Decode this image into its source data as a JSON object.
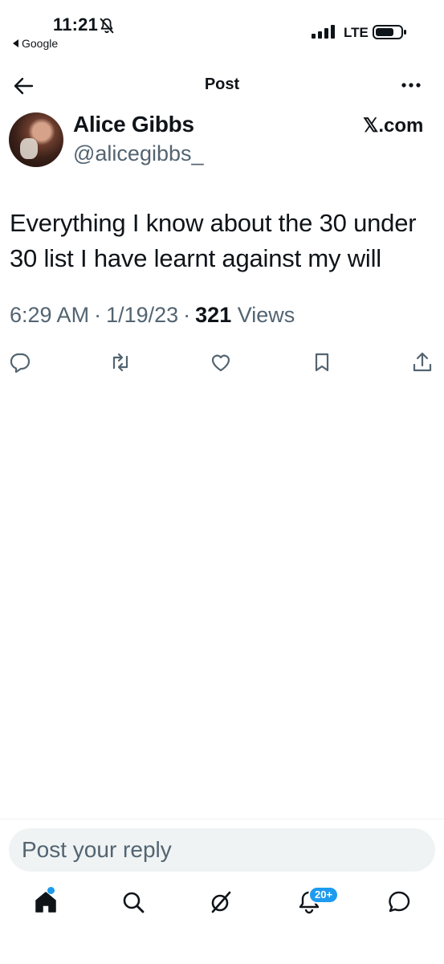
{
  "status_bar": {
    "time": "11:21",
    "back_app": "Google",
    "network": "LTE"
  },
  "header": {
    "title": "Post"
  },
  "author": {
    "name": "Alice Gibbs",
    "handle": "@alicegibbs_",
    "source": "𝕏.com"
  },
  "post": {
    "text": "Everything I know about the 30 under 30 list I have learnt against my will",
    "time": "6:29 AM",
    "sep1": "·",
    "date": "1/19/23",
    "sep2": "·",
    "views_count": "321",
    "views_label": "Views"
  },
  "actions": [
    "reply-icon",
    "repost-icon",
    "like-icon",
    "bookmark-icon",
    "share-icon"
  ],
  "reply": {
    "placeholder": "Post your reply"
  },
  "bottom_nav": {
    "items": [
      "home-icon",
      "search-icon",
      "grok-icon",
      "notifications-icon",
      "messages-icon"
    ],
    "notifications_badge": "20+"
  },
  "colors": {
    "accent": "#1d9bf0",
    "text_primary": "#0f1419",
    "text_secondary": "#536471",
    "reply_bg": "#eff3f4"
  }
}
